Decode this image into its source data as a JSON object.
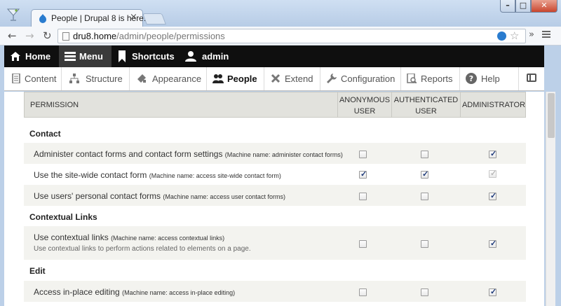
{
  "browser": {
    "tab_title": "People | Drupal 8 is here!",
    "tab_close": "×",
    "url_host": "dru8.home",
    "url_path": "/admin/people/permissions",
    "ext_more": "»",
    "min": "–",
    "max": "□",
    "close": "✕"
  },
  "nav": {
    "back": "←",
    "forward": "→",
    "reload": "↻"
  },
  "toolbar": {
    "home": "Home",
    "menu": "Menu",
    "shortcuts": "Shortcuts",
    "user": "admin"
  },
  "tray": {
    "items": [
      {
        "label": "Content",
        "icon": "content-icon"
      },
      {
        "label": "Structure",
        "icon": "structure-icon"
      },
      {
        "label": "Appearance",
        "icon": "appearance-icon"
      },
      {
        "label": "People",
        "icon": "people-icon"
      },
      {
        "label": "Extend",
        "icon": "extend-icon"
      },
      {
        "label": "Configuration",
        "icon": "configuration-icon"
      },
      {
        "label": "Reports",
        "icon": "reports-icon"
      },
      {
        "label": "Help",
        "icon": "help-icon"
      }
    ]
  },
  "table": {
    "col_permission": "PERMISSION",
    "col_anon_1": "ANONYMOUS",
    "col_anon_2": "USER",
    "col_auth_1": "AUTHENTICATED",
    "col_auth_2": "USER",
    "col_admin": "ADMINISTRATOR"
  },
  "permissions": {
    "contact_module": "Contact",
    "p1_title": "Administer contact forms and contact form settings",
    "p1_machine": "(Machine name: administer contact forms)",
    "p1_checks": [
      false,
      false,
      true
    ],
    "p2_title": "Use the site-wide contact form",
    "p2_machine": "(Machine name: access site-wide contact form)",
    "p2_checks": [
      true,
      true,
      true
    ],
    "p3_title": "Use users' personal contact forms",
    "p3_machine": "(Machine name: access user contact forms)",
    "p3_checks": [
      false,
      false,
      true
    ],
    "contextual_module": "Contextual Links",
    "p4_title": "Use contextual links",
    "p4_machine": "(Machine name: access contextual links)",
    "p4_desc": "Use contextual links to perform actions related to elements on a page.",
    "p4_checks": [
      false,
      false,
      true
    ],
    "edit_module": "Edit",
    "p5_title": "Access in-place editing",
    "p5_machine": "(Machine name: access in-place editing)",
    "p5_checks": [
      false,
      false,
      true
    ]
  }
}
